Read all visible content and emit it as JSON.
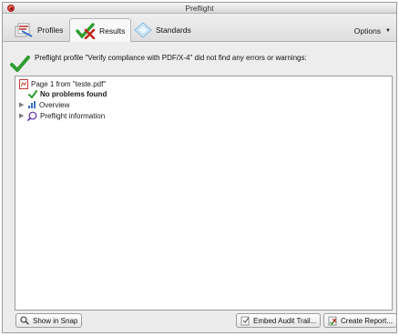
{
  "window": {
    "title": "Preflight"
  },
  "tabs": [
    {
      "label": "Profiles",
      "icon": "profiles-icon",
      "active": false
    },
    {
      "label": "Results",
      "icon": "results-icon",
      "active": true
    },
    {
      "label": "Standards",
      "icon": "standards-icon",
      "active": false
    }
  ],
  "options": {
    "label": "Options",
    "icon": "caret-down-icon"
  },
  "status": {
    "message": "Preflight profile \"Verify compliance with PDF/X-4\" did not find any errors or warnings:",
    "icon": "green-check-icon"
  },
  "tree": {
    "page_label": "Page 1 from \"teste.pdf\"",
    "no_problems_label": "No problems found",
    "overview_label": "Overview",
    "preflight_info_label": "Preflight information"
  },
  "buttons": {
    "show_in_snap": "Show in Snap",
    "embed_audit_trail": "Embed Audit Trail...",
    "create_report": "Create Report..."
  },
  "colors": {
    "check_green": "#2f9e2f",
    "pdf_red": "#c0261c",
    "close_red": "#d9302a"
  }
}
